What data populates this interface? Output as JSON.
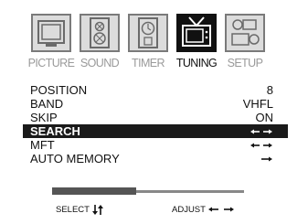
{
  "tabs": [
    {
      "label": "PICTURE",
      "icon": "picture-icon",
      "active": false
    },
    {
      "label": "SOUND",
      "icon": "sound-icon",
      "active": false
    },
    {
      "label": "TIMER",
      "icon": "timer-icon",
      "active": false
    },
    {
      "label": "TUNING",
      "icon": "tv-antenna-icon",
      "active": true
    },
    {
      "label": "SETUP",
      "icon": "setup-icon",
      "active": false
    }
  ],
  "menu": [
    {
      "key": "POSITION",
      "value": "8",
      "selected": false
    },
    {
      "key": "BAND",
      "value": "VHFL",
      "selected": false
    },
    {
      "key": "SKIP",
      "value": "ON",
      "selected": false
    },
    {
      "key": "SEARCH",
      "value": "",
      "selected": true,
      "arrows": "left-right"
    },
    {
      "key": "MFT",
      "value": "",
      "selected": false,
      "arrows": "left-right"
    },
    {
      "key": "AUTO MEMORY",
      "value": "",
      "selected": false,
      "arrows": "right"
    }
  ],
  "footer": {
    "select_label": "SELECT",
    "adjust_label": "ADJUST"
  },
  "progress": 0.44,
  "colors": {
    "active_tab": "#111111",
    "inactive_tab": "#dcdcdc",
    "selected_row": "#1a1a1a"
  }
}
